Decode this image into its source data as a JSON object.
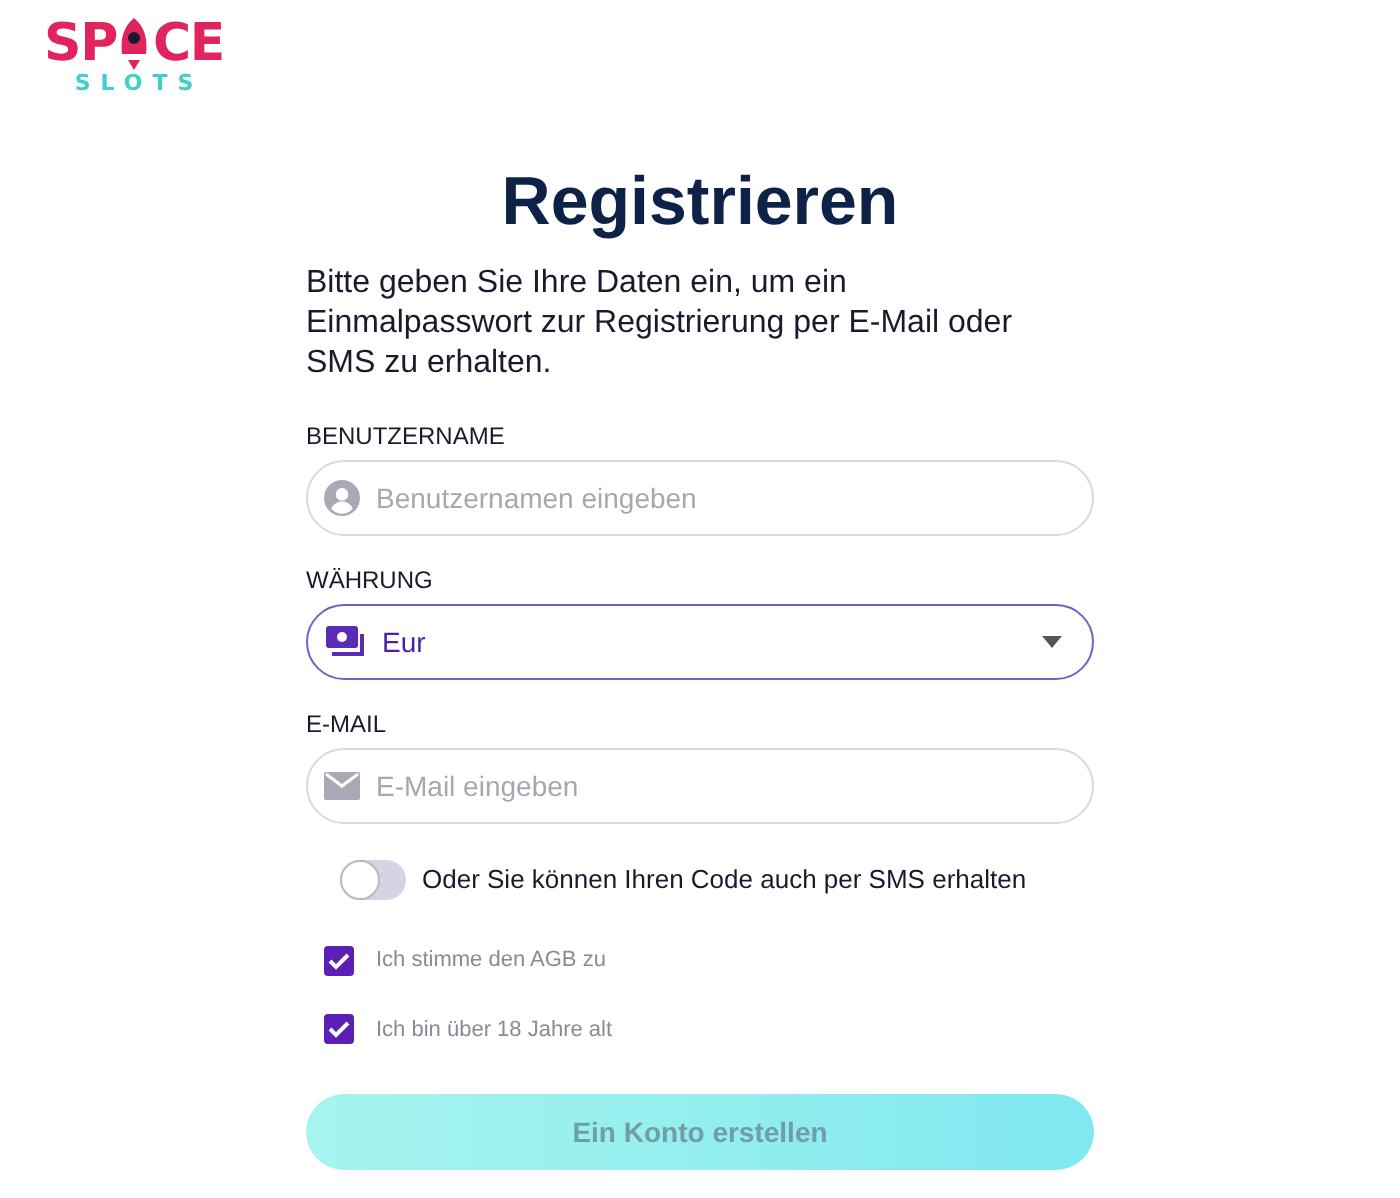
{
  "logo": {
    "top_left": "SP",
    "top_right": "CE",
    "bottom": "SLOTS"
  },
  "title": "Registrieren",
  "description": "Bitte geben Sie Ihre Daten ein, um ein Einmalpasswort zur Registrierung per E-Mail oder SMS zu erhalten.",
  "fields": [
    {
      "kind": "username",
      "label": "BENUTZERNAME",
      "placeholder": "Benutzernamen eingeben",
      "focused": false
    },
    {
      "kind": "currency",
      "label": "WÄHRUNG",
      "value": "Eur",
      "focused": true
    },
    {
      "kind": "email",
      "label": "E-MAIL",
      "placeholder": "E-Mail eingeben",
      "focused": false
    }
  ],
  "sms_toggle": {
    "label": "Oder Sie können Ihren Code auch per SMS erhalten",
    "on": false
  },
  "checkboxes": [
    {
      "label": "Ich stimme den AGB zu",
      "checked": true
    },
    {
      "label": "Ich bin über 18 Jahre alt",
      "checked": true
    }
  ],
  "submit": {
    "label": "Ein Konto erstellen",
    "disabled": true
  }
}
